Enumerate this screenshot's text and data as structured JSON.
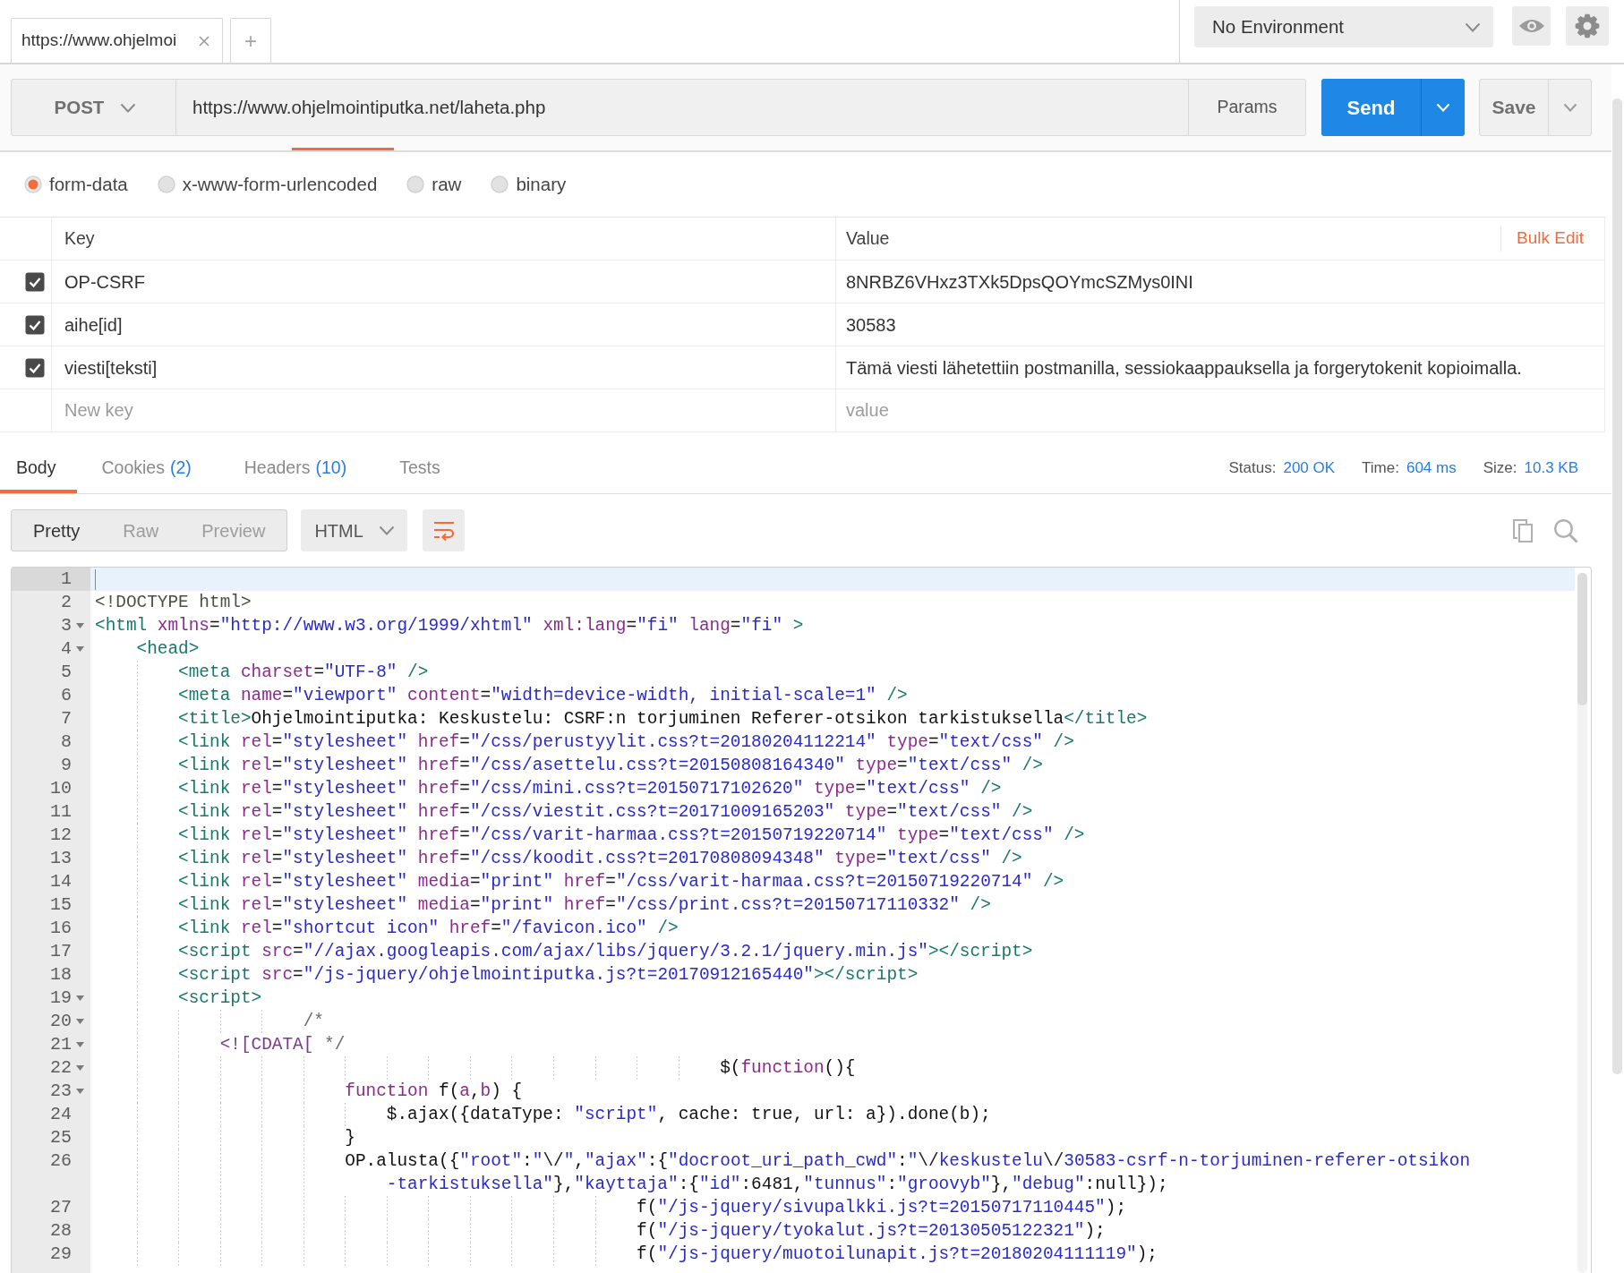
{
  "tabs": [
    {
      "label": "https://www.ohjelmoi",
      "selected": true
    }
  ],
  "new_tab_button": "+",
  "environment": {
    "value": "No Environment"
  },
  "request": {
    "method": "POST",
    "url": "https://www.ohjelmointiputka.net/laheta.php",
    "params_button": "Params",
    "send_button": "Send",
    "save_button": "Save"
  },
  "body_types": [
    {
      "label": "form-data",
      "selected": true
    },
    {
      "label": "x-www-form-urlencoded",
      "selected": false
    },
    {
      "label": "raw",
      "selected": false
    },
    {
      "label": "binary",
      "selected": false
    }
  ],
  "form_table": {
    "columns": [
      "Key",
      "Value"
    ],
    "bulk_edit": "Bulk Edit",
    "rows": [
      {
        "checked": true,
        "key": "OP-CSRF",
        "value": "8NRBZ6VHxz3TXk5DpsQOYmcSZMys0INI"
      },
      {
        "checked": true,
        "key": "aihe[id]",
        "value": "30583"
      },
      {
        "checked": true,
        "key": "viesti[teksti]",
        "value": "Tämä viesti lähetettiin postmanilla, sessiokaappauksella ja forgerytokenit kopioimalla."
      }
    ],
    "new_row": {
      "key": {
        "placeholder": "New key"
      },
      "value": {
        "placeholder": "value"
      }
    }
  },
  "response_tabs": [
    {
      "label": "Body",
      "selected": true
    },
    {
      "label": "Cookies",
      "count": "(2)",
      "selected": false
    },
    {
      "label": "Headers",
      "count": "(10)",
      "selected": false
    },
    {
      "label": "Tests",
      "selected": false
    }
  ],
  "response_stats": [
    {
      "label": "Status:",
      "value": "200 OK"
    },
    {
      "label": "Time:",
      "value": "604 ms"
    },
    {
      "label": "Size:",
      "value": "10.3 KB"
    }
  ],
  "view_modes": [
    {
      "label": "Pretty",
      "selected": true
    },
    {
      "label": "Raw",
      "selected": false
    },
    {
      "label": "Preview",
      "selected": false
    }
  ],
  "format": {
    "value": "HTML"
  },
  "wrap_toggle": {
    "on": true
  },
  "editor": {
    "lines": [
      {
        "number": "1",
        "active": true,
        "foldable": false
      },
      {
        "number": "2",
        "active": false,
        "foldable": false,
        "tokens": [
          {
            "kind": "doctype",
            "text": "<!DOCTYPE html>"
          }
        ]
      },
      {
        "number": "3",
        "active": false,
        "foldable": true,
        "tokens": [
          {
            "kind": "tag",
            "text": "<html"
          },
          {
            "kind": "attr",
            "text": " xmlns"
          },
          {
            "kind": "text",
            "text": "="
          },
          {
            "kind": "string",
            "text": "\"http://www.w3.org/1999/xhtml\""
          },
          {
            "kind": "attr",
            "text": " xml:lang"
          },
          {
            "kind": "text",
            "text": "="
          },
          {
            "kind": "string",
            "text": "\"fi\""
          },
          {
            "kind": "attr",
            "text": " lang"
          },
          {
            "kind": "text",
            "text": "="
          },
          {
            "kind": "string",
            "text": "\"fi\""
          },
          {
            "kind": "tag",
            "text": " >"
          }
        ]
      },
      {
        "number": "4",
        "active": false,
        "foldable": true,
        "tokens": [
          {
            "kind": "tag",
            "text": "    <head>"
          }
        ]
      },
      {
        "number": "5",
        "active": false,
        "foldable": false,
        "tokens": [
          {
            "kind": "tag",
            "text": "        <meta"
          },
          {
            "kind": "attr",
            "text": " charset"
          },
          {
            "kind": "text",
            "text": "="
          },
          {
            "kind": "string",
            "text": "\"UTF-8\""
          },
          {
            "kind": "tag",
            "text": " />"
          }
        ]
      },
      {
        "number": "6",
        "active": false,
        "foldable": false,
        "tokens": [
          {
            "kind": "tag",
            "text": "        <meta"
          },
          {
            "kind": "attr",
            "text": " name"
          },
          {
            "kind": "text",
            "text": "="
          },
          {
            "kind": "string",
            "text": "\"viewport\""
          },
          {
            "kind": "attr",
            "text": " content"
          },
          {
            "kind": "text",
            "text": "="
          },
          {
            "kind": "string",
            "text": "\"width=device-width, initial-scale=1\""
          },
          {
            "kind": "tag",
            "text": " />"
          }
        ]
      },
      {
        "number": "7",
        "active": false,
        "foldable": false,
        "tokens": [
          {
            "kind": "tag",
            "text": "        <title>"
          },
          {
            "kind": "text",
            "text": "Ohjelmointiputka: Keskustelu: CSRF:n torjuminen Referer-otsikon tarkistuksella"
          },
          {
            "kind": "tag",
            "text": "</title>"
          }
        ]
      },
      {
        "number": "8",
        "active": false,
        "foldable": false,
        "tokens": [
          {
            "kind": "tag",
            "text": "        <link"
          },
          {
            "kind": "attr",
            "text": " rel"
          },
          {
            "kind": "text",
            "text": "="
          },
          {
            "kind": "string",
            "text": "\"stylesheet\""
          },
          {
            "kind": "attr",
            "text": " href"
          },
          {
            "kind": "text",
            "text": "="
          },
          {
            "kind": "string",
            "text": "\"/css/perustyylit.css?t=20180204112214\""
          },
          {
            "kind": "attr",
            "text": " type"
          },
          {
            "kind": "text",
            "text": "="
          },
          {
            "kind": "string",
            "text": "\"text/css\""
          },
          {
            "kind": "tag",
            "text": " />"
          }
        ]
      },
      {
        "number": "9",
        "active": false,
        "foldable": false,
        "tokens": [
          {
            "kind": "tag",
            "text": "        <link"
          },
          {
            "kind": "attr",
            "text": " rel"
          },
          {
            "kind": "text",
            "text": "="
          },
          {
            "kind": "string",
            "text": "\"stylesheet\""
          },
          {
            "kind": "attr",
            "text": " href"
          },
          {
            "kind": "text",
            "text": "="
          },
          {
            "kind": "string",
            "text": "\"/css/asettelu.css?t=20150808164340\""
          },
          {
            "kind": "attr",
            "text": " type"
          },
          {
            "kind": "text",
            "text": "="
          },
          {
            "kind": "string",
            "text": "\"text/css\""
          },
          {
            "kind": "tag",
            "text": " />"
          }
        ]
      },
      {
        "number": "10",
        "active": false,
        "foldable": false,
        "tokens": [
          {
            "kind": "tag",
            "text": "        <link"
          },
          {
            "kind": "attr",
            "text": " rel"
          },
          {
            "kind": "text",
            "text": "="
          },
          {
            "kind": "string",
            "text": "\"stylesheet\""
          },
          {
            "kind": "attr",
            "text": " href"
          },
          {
            "kind": "text",
            "text": "="
          },
          {
            "kind": "string",
            "text": "\"/css/mini.css?t=20150717102620\""
          },
          {
            "kind": "attr",
            "text": " type"
          },
          {
            "kind": "text",
            "text": "="
          },
          {
            "kind": "string",
            "text": "\"text/css\""
          },
          {
            "kind": "tag",
            "text": " />"
          }
        ]
      },
      {
        "number": "11",
        "active": false,
        "foldable": false,
        "tokens": [
          {
            "kind": "tag",
            "text": "        <link"
          },
          {
            "kind": "attr",
            "text": " rel"
          },
          {
            "kind": "text",
            "text": "="
          },
          {
            "kind": "string",
            "text": "\"stylesheet\""
          },
          {
            "kind": "attr",
            "text": " href"
          },
          {
            "kind": "text",
            "text": "="
          },
          {
            "kind": "string",
            "text": "\"/css/viestit.css?t=20171009165203\""
          },
          {
            "kind": "attr",
            "text": " type"
          },
          {
            "kind": "text",
            "text": "="
          },
          {
            "kind": "string",
            "text": "\"text/css\""
          },
          {
            "kind": "tag",
            "text": " />"
          }
        ]
      },
      {
        "number": "12",
        "active": false,
        "foldable": false,
        "tokens": [
          {
            "kind": "tag",
            "text": "        <link"
          },
          {
            "kind": "attr",
            "text": " rel"
          },
          {
            "kind": "text",
            "text": "="
          },
          {
            "kind": "string",
            "text": "\"stylesheet\""
          },
          {
            "kind": "attr",
            "text": " href"
          },
          {
            "kind": "text",
            "text": "="
          },
          {
            "kind": "string",
            "text": "\"/css/varit-harmaa.css?t=20150719220714\""
          },
          {
            "kind": "attr",
            "text": " type"
          },
          {
            "kind": "text",
            "text": "="
          },
          {
            "kind": "string",
            "text": "\"text/css\""
          },
          {
            "kind": "tag",
            "text": " />"
          }
        ]
      },
      {
        "number": "13",
        "active": false,
        "foldable": false,
        "tokens": [
          {
            "kind": "tag",
            "text": "        <link"
          },
          {
            "kind": "attr",
            "text": " rel"
          },
          {
            "kind": "text",
            "text": "="
          },
          {
            "kind": "string",
            "text": "\"stylesheet\""
          },
          {
            "kind": "attr",
            "text": " href"
          },
          {
            "kind": "text",
            "text": "="
          },
          {
            "kind": "string",
            "text": "\"/css/koodit.css?t=20170808094348\""
          },
          {
            "kind": "attr",
            "text": " type"
          },
          {
            "kind": "text",
            "text": "="
          },
          {
            "kind": "string",
            "text": "\"text/css\""
          },
          {
            "kind": "tag",
            "text": " />"
          }
        ]
      },
      {
        "number": "14",
        "active": false,
        "foldable": false,
        "tokens": [
          {
            "kind": "tag",
            "text": "        <link"
          },
          {
            "kind": "attr",
            "text": " rel"
          },
          {
            "kind": "text",
            "text": "="
          },
          {
            "kind": "string",
            "text": "\"stylesheet\""
          },
          {
            "kind": "attr",
            "text": " media"
          },
          {
            "kind": "text",
            "text": "="
          },
          {
            "kind": "string",
            "text": "\"print\""
          },
          {
            "kind": "attr",
            "text": " href"
          },
          {
            "kind": "text",
            "text": "="
          },
          {
            "kind": "string",
            "text": "\"/css/varit-harmaa.css?t=20150719220714\""
          },
          {
            "kind": "tag",
            "text": " />"
          }
        ]
      },
      {
        "number": "15",
        "active": false,
        "foldable": false,
        "tokens": [
          {
            "kind": "tag",
            "text": "        <link"
          },
          {
            "kind": "attr",
            "text": " rel"
          },
          {
            "kind": "text",
            "text": "="
          },
          {
            "kind": "string",
            "text": "\"stylesheet\""
          },
          {
            "kind": "attr",
            "text": " media"
          },
          {
            "kind": "text",
            "text": "="
          },
          {
            "kind": "string",
            "text": "\"print\""
          },
          {
            "kind": "attr",
            "text": " href"
          },
          {
            "kind": "text",
            "text": "="
          },
          {
            "kind": "string",
            "text": "\"/css/print.css?t=20150717110332\""
          },
          {
            "kind": "tag",
            "text": " />"
          }
        ]
      },
      {
        "number": "16",
        "active": false,
        "foldable": false,
        "tokens": [
          {
            "kind": "tag",
            "text": "        <link"
          },
          {
            "kind": "attr",
            "text": " rel"
          },
          {
            "kind": "text",
            "text": "="
          },
          {
            "kind": "string",
            "text": "\"shortcut icon\""
          },
          {
            "kind": "attr",
            "text": " href"
          },
          {
            "kind": "text",
            "text": "="
          },
          {
            "kind": "string",
            "text": "\"/favicon.ico\""
          },
          {
            "kind": "tag",
            "text": " />"
          }
        ]
      },
      {
        "number": "17",
        "active": false,
        "foldable": false,
        "tokens": [
          {
            "kind": "tag",
            "text": "        <script"
          },
          {
            "kind": "attr",
            "text": " src"
          },
          {
            "kind": "text",
            "text": "="
          },
          {
            "kind": "string",
            "text": "\"//ajax.googleapis.com/ajax/libs/jquery/3.2.1/jquery.min.js\""
          },
          {
            "kind": "tag",
            "text": "></script>"
          }
        ]
      },
      {
        "number": "18",
        "active": false,
        "foldable": false,
        "tokens": [
          {
            "kind": "tag",
            "text": "        <script"
          },
          {
            "kind": "attr",
            "text": " src"
          },
          {
            "kind": "text",
            "text": "="
          },
          {
            "kind": "string",
            "text": "\"/js-jquery/ohjelmointiputka.js?t=20170912165440\""
          },
          {
            "kind": "tag",
            "text": "></script>"
          }
        ]
      },
      {
        "number": "19",
        "active": false,
        "foldable": true,
        "tokens": [
          {
            "kind": "tag",
            "text": "        <script>"
          }
        ]
      },
      {
        "number": "20",
        "active": false,
        "foldable": true,
        "tokens": [
          {
            "kind": "comment",
            "text": "                    /*"
          }
        ]
      },
      {
        "number": "21",
        "active": false,
        "foldable": true,
        "tokens": [
          {
            "kind": "cdata",
            "text": "            <![CDATA["
          },
          {
            "kind": "comment",
            "text": " */"
          }
        ]
      },
      {
        "number": "22",
        "active": false,
        "foldable": true,
        "tokens": [
          {
            "kind": "text",
            "text": "                                                            $("
          },
          {
            "kind": "keyword",
            "text": "function"
          },
          {
            "kind": "text",
            "text": "(){"
          }
        ]
      },
      {
        "number": "23",
        "active": false,
        "foldable": true,
        "tokens": [
          {
            "kind": "keyword",
            "text": "                        function"
          },
          {
            "kind": "text",
            "text": " f("
          },
          {
            "kind": "param",
            "text": "a"
          },
          {
            "kind": "text",
            "text": ","
          },
          {
            "kind": "param",
            "text": "b"
          },
          {
            "kind": "text",
            "text": ") {"
          }
        ]
      },
      {
        "number": "24",
        "active": false,
        "foldable": false,
        "tokens": [
          {
            "kind": "text",
            "text": "                            $.ajax({dataType: "
          },
          {
            "kind": "string",
            "text": "\"script\""
          },
          {
            "kind": "text",
            "text": ", cache: true, url: a}).done(b);"
          }
        ]
      },
      {
        "number": "25",
        "active": false,
        "foldable": false,
        "tokens": [
          {
            "kind": "text",
            "text": "                        }"
          }
        ]
      },
      {
        "number": "26",
        "active": false,
        "foldable": false,
        "tokens": [
          {
            "kind": "text",
            "text": "                        OP.alusta({"
          },
          {
            "kind": "string",
            "text": "\"root\""
          },
          {
            "kind": "text",
            "text": ":"
          },
          {
            "kind": "string",
            "text": "\""
          },
          {
            "kind": "escape",
            "text": "\\/"
          },
          {
            "kind": "string",
            "text": "\""
          },
          {
            "kind": "text",
            "text": ","
          },
          {
            "kind": "string",
            "text": "\"ajax\""
          },
          {
            "kind": "text",
            "text": ":{"
          },
          {
            "kind": "string",
            "text": "\"docroot_uri_path_cwd\""
          },
          {
            "kind": "text",
            "text": ":"
          },
          {
            "kind": "string",
            "text": "\""
          },
          {
            "kind": "escape",
            "text": "\\/"
          },
          {
            "kind": "string",
            "text": "keskustelu"
          },
          {
            "kind": "escape",
            "text": "\\/"
          },
          {
            "kind": "string",
            "text": "30583-csrf-n-torjuminen-referer-otsikon"
          }
        ],
        "continued": [
          {
            "kind": "string",
            "text": "-tarkistuksella\""
          },
          {
            "kind": "text",
            "text": "},"
          },
          {
            "kind": "string",
            "text": "\"kayttaja\""
          },
          {
            "kind": "text",
            "text": ":{"
          },
          {
            "kind": "string",
            "text": "\"id\""
          },
          {
            "kind": "text",
            "text": ":6481,"
          },
          {
            "kind": "string",
            "text": "\"tunnus\""
          },
          {
            "kind": "text",
            "text": ":"
          },
          {
            "kind": "string",
            "text": "\"groovyb\""
          },
          {
            "kind": "text",
            "text": "},"
          },
          {
            "kind": "string",
            "text": "\"debug\""
          },
          {
            "kind": "text",
            "text": ":null});"
          }
        ]
      },
      {
        "number": "27",
        "active": false,
        "foldable": false,
        "tokens": [
          {
            "kind": "text",
            "text": "                                                    f("
          },
          {
            "kind": "string",
            "text": "\"/js-jquery/sivupalkki.js?t=20150717110445\""
          },
          {
            "kind": "text",
            "text": ");"
          }
        ]
      },
      {
        "number": "28",
        "active": false,
        "foldable": false,
        "tokens": [
          {
            "kind": "text",
            "text": "                                                    f("
          },
          {
            "kind": "string",
            "text": "\"/js-jquery/tyokalut.js?t=20130505122321\""
          },
          {
            "kind": "text",
            "text": ");"
          }
        ]
      },
      {
        "number": "29",
        "active": false,
        "foldable": false,
        "tokens": [
          {
            "kind": "text",
            "text": "                                                    f("
          },
          {
            "kind": "string",
            "text": "\"/js-jquery/muotoilunapit.js?t=20180204111119\""
          },
          {
            "kind": "text",
            "text": ");"
          }
        ]
      }
    ]
  }
}
